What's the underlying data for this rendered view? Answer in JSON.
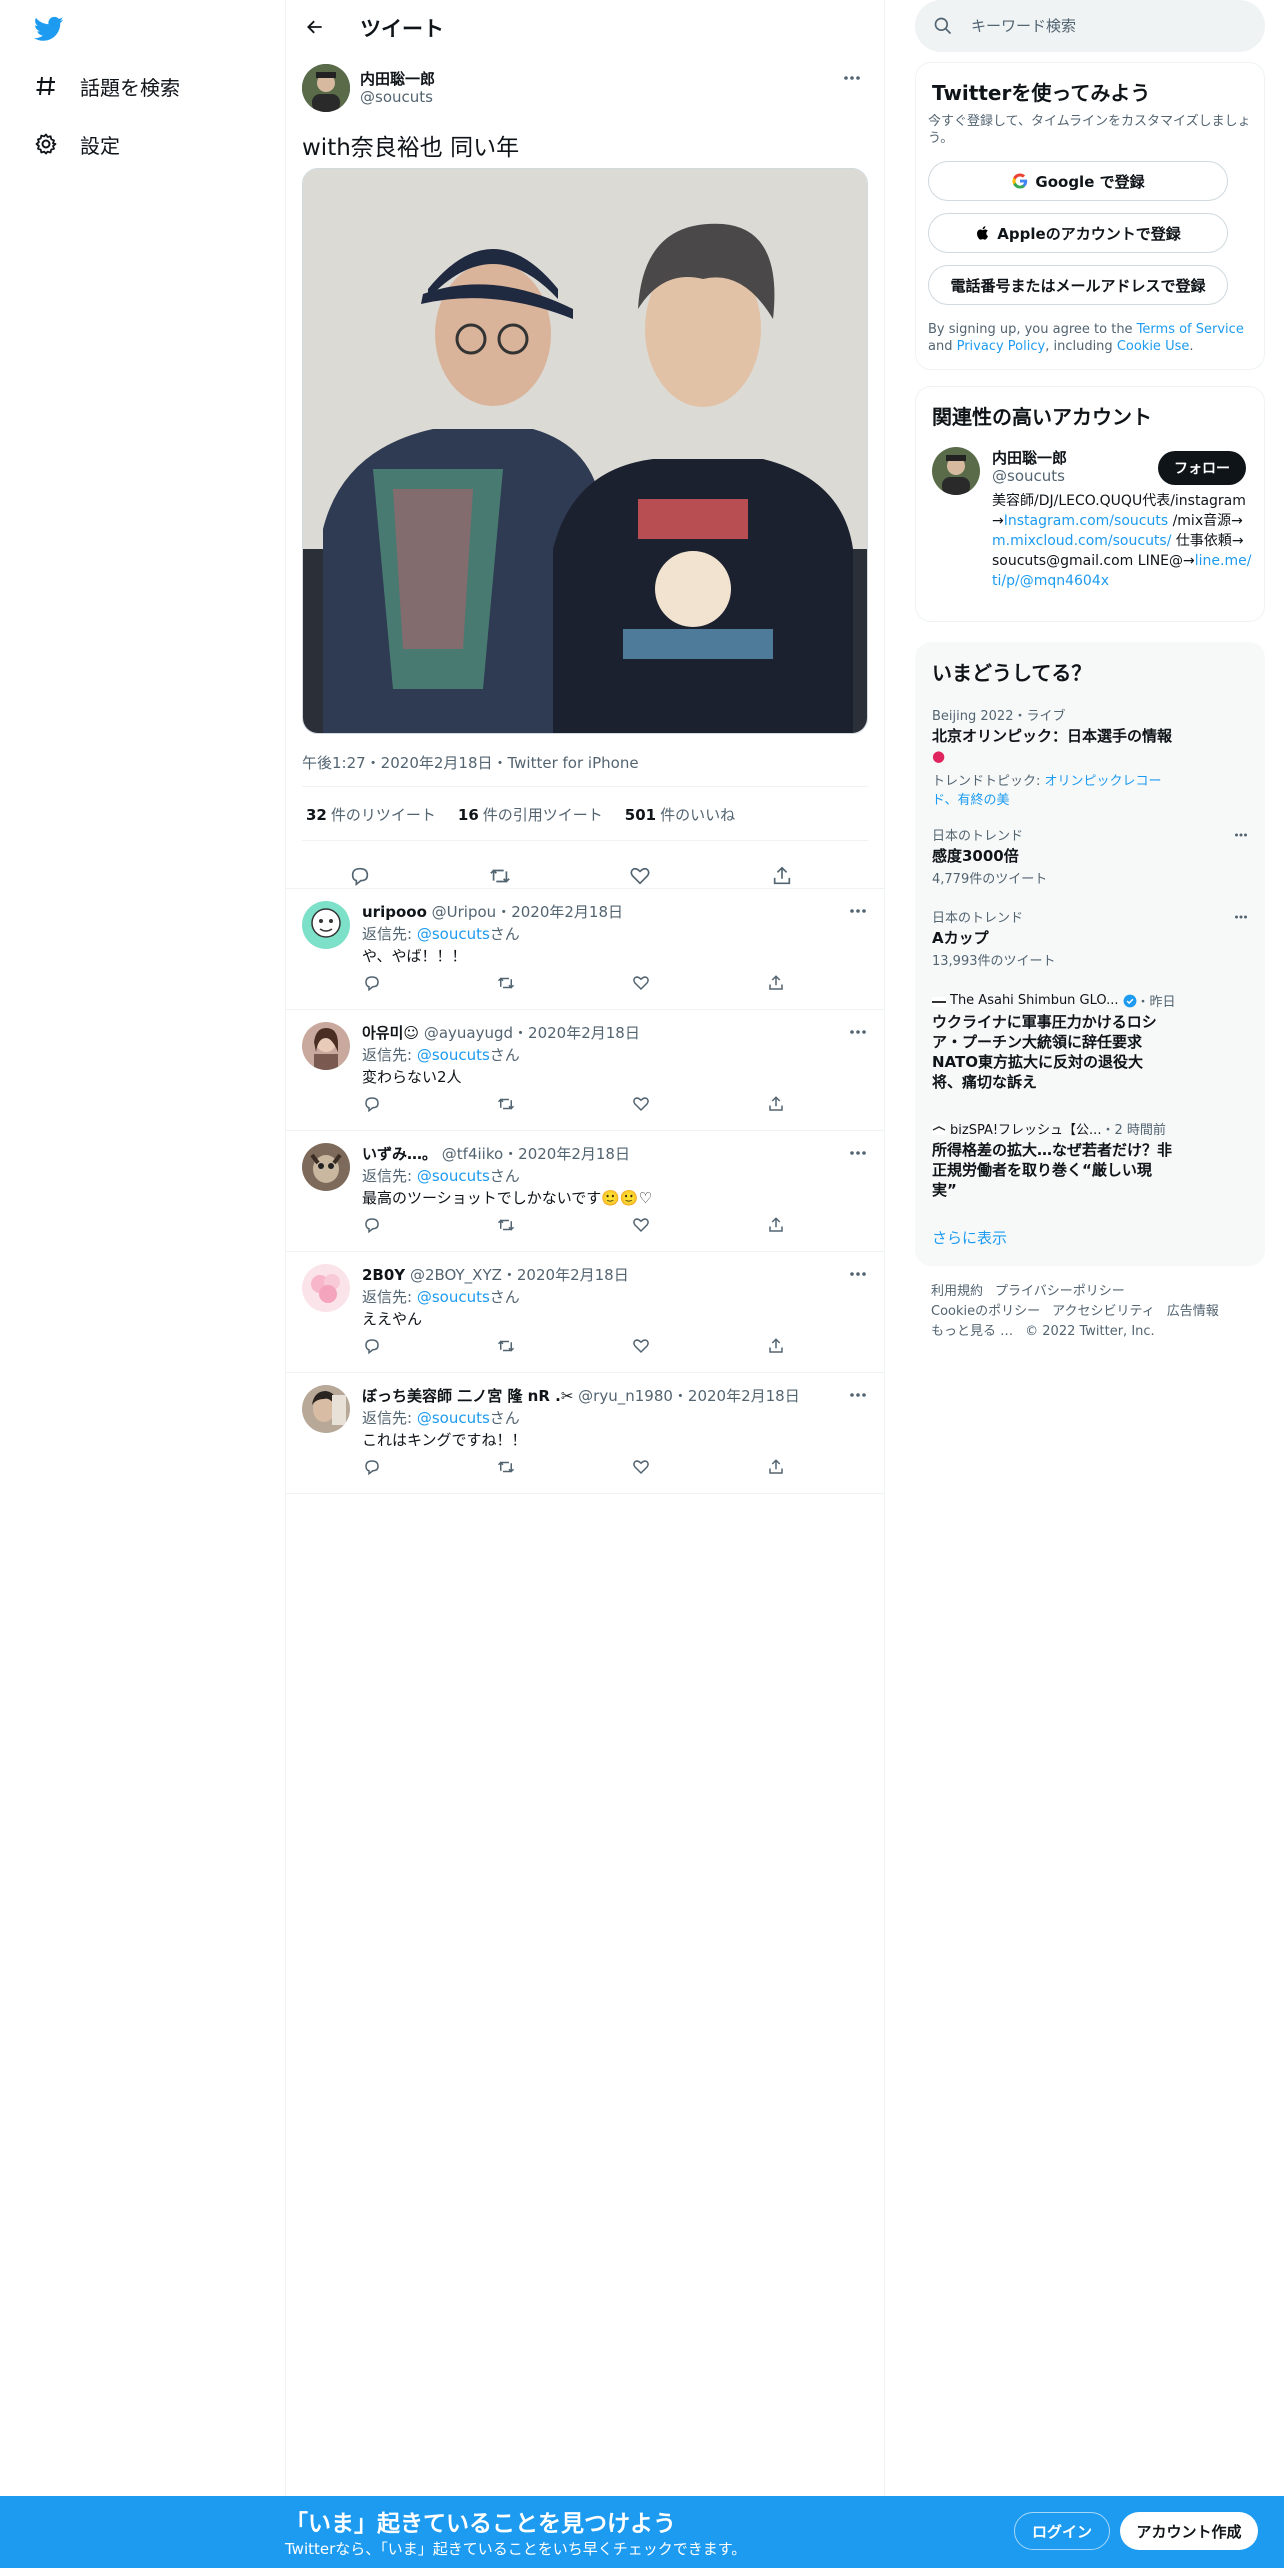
{
  "nav": {
    "explore_label": "話題を検索",
    "settings_label": "設定"
  },
  "header": {
    "title": "ツイート"
  },
  "tweet": {
    "author_name": "内田聡一郎",
    "author_handle": "@soucuts",
    "text": "with奈良裕也 同い年",
    "meta": "午後1:27・2020年2月18日・Twitter for iPhone",
    "stats": [
      {
        "count": "32",
        "label": "件のリツイート"
      },
      {
        "count": "16",
        "label": "件の引用ツイート"
      },
      {
        "count": "501",
        "label": "件のいいね"
      }
    ]
  },
  "replies": [
    {
      "name": "uripooo",
      "handle": "@Uripou",
      "date": "・2020年2月18日",
      "reply_prefix": "返信先: ",
      "reply_to": "@soucuts",
      "reply_suffix": "さん",
      "text": "や、やば！！！"
    },
    {
      "name": "아유미☺",
      "handle": "@ayuayugd",
      "date": "・2020年2月18日",
      "reply_prefix": "返信先: ",
      "reply_to": "@soucuts",
      "reply_suffix": "さん",
      "text": "変わらない2人"
    },
    {
      "name": "いずみ…。",
      "handle": "@tf4iiko",
      "date": "・2020年2月18日",
      "reply_prefix": "返信先: ",
      "reply_to": "@soucuts",
      "reply_suffix": "さん",
      "text": "最高のツーショットでしかないです🙂🙂♡"
    },
    {
      "name": "2B0Y",
      "handle": "@2BOY_XYZ",
      "date": "・2020年2月18日",
      "reply_prefix": "返信先: ",
      "reply_to": "@soucuts",
      "reply_suffix": "さん",
      "text": "ええやん"
    },
    {
      "name": "ぼっち美容師 二ノ宮 隆 nR .✂︎",
      "handle": "@ryu_n1980",
      "date": "・2020年2月18日",
      "reply_prefix": "返信先: ",
      "reply_to": "@soucuts",
      "reply_suffix": "さん",
      "text": "これはキングですね！！"
    }
  ],
  "search": {
    "placeholder": "キーワード検索"
  },
  "signup_card": {
    "title": "Twitterを使ってみよう",
    "subtitle": "今すぐ登録して、タイムラインをカスタマイズしましょう。",
    "google_label": "Google で登録",
    "apple_label": "Appleのアカウントで登録",
    "phone_label": "電話番号またはメールアドレスで登録",
    "terms_1": "By signing up, you agree to the ",
    "terms_link": "Terms of Service",
    "terms_2": " and ",
    "privacy_link": "Privacy Policy",
    "terms_3": ", including ",
    "cookie_link": "Cookie Use",
    "terms_4": "."
  },
  "relevant_card": {
    "title": "関連性の高いアカウント",
    "name": "内田聡一郎",
    "handle": "@soucuts",
    "follow_label": "フォロー",
    "bio_1": "美容師/DJ/LECO.QUQU代表/instagram→",
    "bio_link1": "Instagram.com/soucuts",
    "bio_2": " /mix音源→",
    "bio_link2": "m.mixcloud.com/soucuts/",
    "bio_3": " 仕事依頼→ soucuts@gmail.com LINE@→",
    "bio_link3": "line.me/ti/p/@mqn4604x"
  },
  "trends_card": {
    "title": "いまどうしてる？",
    "trend1_context": "Beijing 2022・ライブ",
    "trend1_title": "北京オリンピック：日本選手の情報",
    "trend1_topic_prefix": "トレンドトピック: ",
    "trend1_topic": "オリンピックレコード、有終の美",
    "trend2_context": "日本のトレンド",
    "trend2_title": "感度3000倍",
    "trend2_count": "4,779件のツイート",
    "trend3_context": "日本のトレンド",
    "trend3_title": "Aカップ",
    "trend3_count": "13,993件のツイート",
    "news1_source": "The Asahi Shimbun GLO...",
    "news1_time": "・昨日",
    "news1_title": "ウクライナに軍事圧力かけるロシア・プーチン大統領に辞任要求 NATO東方拡大に反対の退役大将、痛切な訴え",
    "news2_source": "bizSPA!フレッシュ【公...",
    "news2_time": "・2 時間前",
    "news2_title": "所得格差の拡大…なぜ若者だけ？非正規労働者を取り巻く“厳しい現実”",
    "show_more": "さらに表示"
  },
  "footer": {
    "terms": "利用規約",
    "privacy": "プライバシーポリシー",
    "cookie": "Cookieのポリシー",
    "accessibility": "アクセシビリティ",
    "ads": "広告情報",
    "more": "もっと見る …",
    "copyright": "© 2022 Twitter, Inc."
  },
  "banner": {
    "title": "「いま」起きていることを見つけよう",
    "subtitle": "Twitterなら、「いま」起きていることをいち早くチェックできます。",
    "login_label": "ログイン",
    "signup_label": "アカウント作成"
  },
  "colors": {
    "accent": "#1d9bf0",
    "text": "#0f1419",
    "muted": "#536471"
  }
}
